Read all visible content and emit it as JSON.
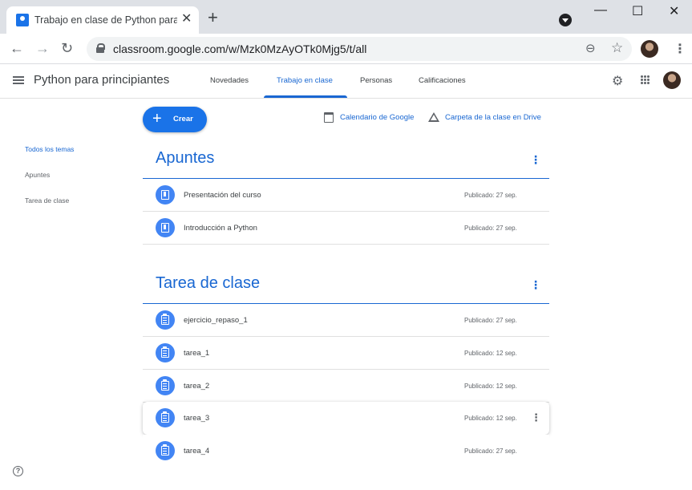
{
  "browser": {
    "tab_title": "Trabajo en clase de Python para principiantes",
    "tab_close": "✕",
    "new_tab": "+",
    "url": "classroom.google.com/w/Mzk0MzAyOTk0Mjg5/t/all",
    "win_minimize": "—",
    "win_maximize": "☐",
    "win_close": "✕"
  },
  "app": {
    "class_name": "Python para principiantes",
    "tabs": [
      {
        "label": "Novedades",
        "active": false
      },
      {
        "label": "Trabajo en clase",
        "active": true
      },
      {
        "label": "Personas",
        "active": false
      },
      {
        "label": "Calificaciones",
        "active": false
      }
    ]
  },
  "sidebar": {
    "items": [
      {
        "label": "Todos los temas",
        "active": true
      },
      {
        "label": "Apuntes",
        "active": false
      },
      {
        "label": "Tarea de clase",
        "active": false
      }
    ]
  },
  "actions": {
    "create_label": "Crear",
    "calendar_label": "Calendario de Google",
    "drive_label": "Carpeta de la clase en Drive"
  },
  "sections": [
    {
      "title": "Apuntes",
      "items": [
        {
          "title": "Presentación del curso",
          "date": "Publicado: 27 sep.",
          "icon": "material-icon"
        },
        {
          "title": "Introducción a Python",
          "date": "Publicado: 27 sep.",
          "icon": "material-icon"
        }
      ]
    },
    {
      "title": "Tarea de clase",
      "items": [
        {
          "title": "ejercicio_repaso_1",
          "date": "Publicado: 27 sep.",
          "icon": "assignment-icon"
        },
        {
          "title": "tarea_1",
          "date": "Publicado: 12 sep.",
          "icon": "assignment-icon"
        },
        {
          "title": "tarea_2",
          "date": "Publicado: 12 sep.",
          "icon": "assignment-icon"
        },
        {
          "title": "tarea_3",
          "date": "Publicado: 12 sep.",
          "icon": "assignment-icon",
          "hovered": true
        },
        {
          "title": "tarea_4",
          "date": "Publicado: 27 sep.",
          "icon": "assignment-icon"
        }
      ]
    }
  ],
  "colors": {
    "accent": "#1967d2",
    "button": "#1a73e8",
    "item_icon_bg": "#4285f4",
    "browser_frame": "#dee1e6"
  }
}
